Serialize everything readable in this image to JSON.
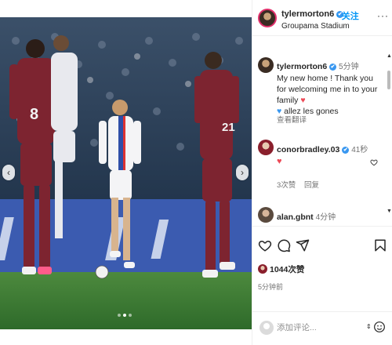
{
  "post": {
    "username": "tylermorton6",
    "verified_mark": "✔",
    "follow_label": "· 关注",
    "location": "Groupama Stadium",
    "more_label": "···"
  },
  "caption": {
    "username": "tylermorton6",
    "time": "5分钟",
    "line1": "My new home ! Thank you for welcoming me in to your family ",
    "heart1": "♥",
    "heart2": "♥",
    "line2": " allez les gones",
    "see_translation": "查看翻译"
  },
  "comments": [
    {
      "username": "conorbradley.03",
      "time": "41秒",
      "text": "♥",
      "likes": "3次赞",
      "reply": "回复"
    },
    {
      "username": "alan.gbnt",
      "time": "4分钟"
    }
  ],
  "actions": {
    "like_count": "1044次赞",
    "post_time": "5分钟前"
  },
  "composer": {
    "placeholder": "添加评论..."
  },
  "media": {
    "jersey_numbers": [
      "8",
      "21"
    ],
    "prev_arrow": "‹",
    "next_arrow": "›"
  },
  "colors": {
    "link_blue": "#0095f6",
    "heart_red": "#ed4956",
    "verified_blue": "#3897f0",
    "pitch_green": "#3d7a35",
    "lyon_maroon": "#7d2430"
  },
  "icons": [
    "heart-icon",
    "comment-icon",
    "share-icon",
    "bookmark-icon",
    "emoji-icon",
    "more-icon"
  ]
}
